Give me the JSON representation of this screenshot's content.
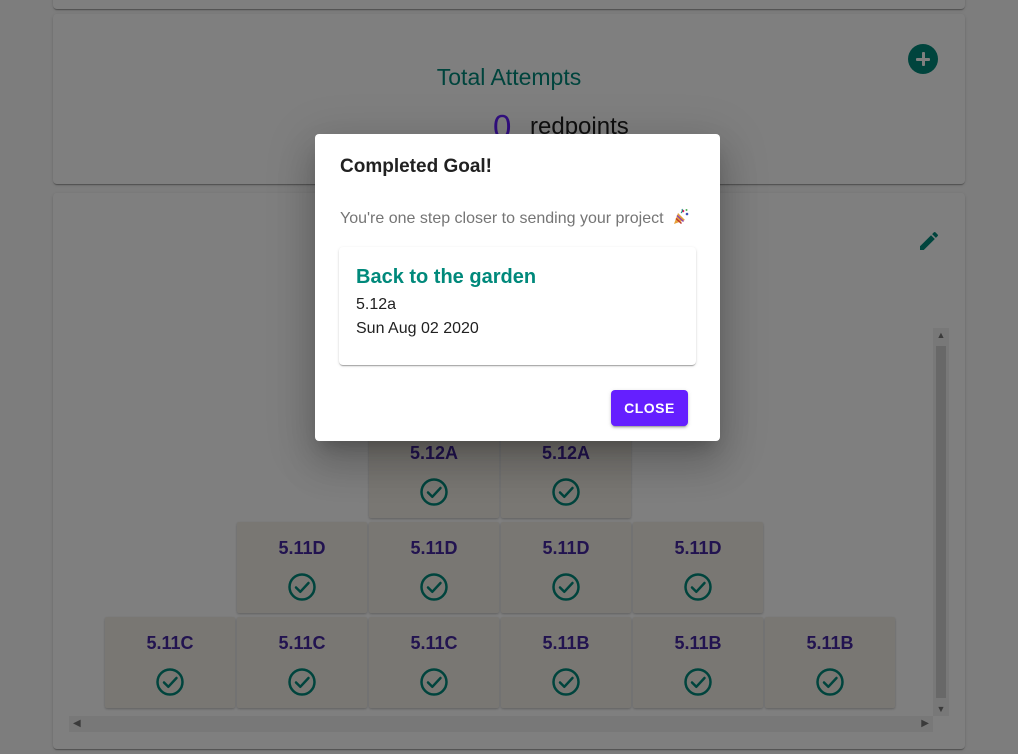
{
  "attempts": {
    "title": "Total Attempts",
    "count": "0",
    "unit": "redpoints",
    "add_icon": "plus-circle-icon"
  },
  "pyramid": {
    "edit_icon": "pencil-icon",
    "check_icon": "check-circle-icon",
    "rows": [
      {
        "tiles": [
          "5.12A",
          "5.12A"
        ]
      },
      {
        "tiles": [
          "5.11D",
          "5.11D",
          "5.11D",
          "5.11D"
        ]
      },
      {
        "tiles": [
          "5.11C",
          "5.11C",
          "5.11C",
          "5.11B",
          "5.11B",
          "5.11B"
        ]
      }
    ]
  },
  "dialog": {
    "title": "Completed Goal!",
    "text": "You're one step closer to sending your project",
    "text_icon": "party-popper-icon",
    "project": {
      "name": "Back to the garden",
      "grade": "5.12a",
      "date": "Sun Aug 02 2020"
    },
    "close_label": "CLOSE"
  },
  "colors": {
    "teal": "#00897b",
    "purple": "#651fff",
    "grade_text": "#4527a0",
    "tile_bg": "#f3efe6"
  }
}
